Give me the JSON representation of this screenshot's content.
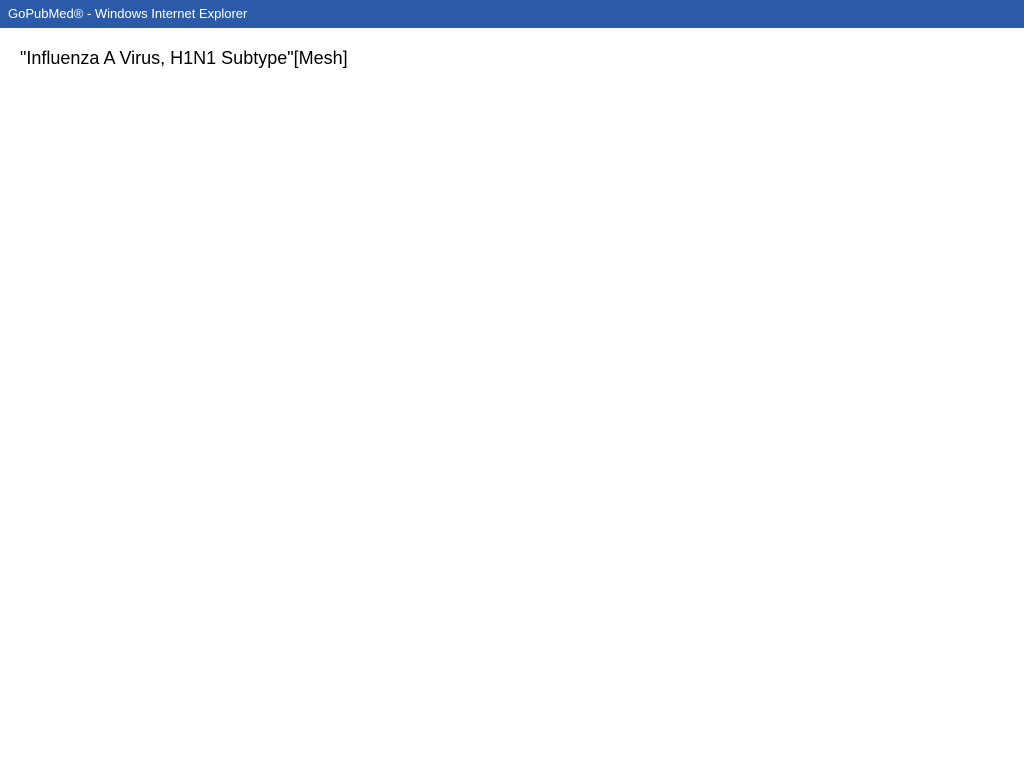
{
  "title": "GoPubMed® - Windows Internet Explorer",
  "query": "\"Influenza A Virus, H1N1 Subtype\"[Mesh]"
}
